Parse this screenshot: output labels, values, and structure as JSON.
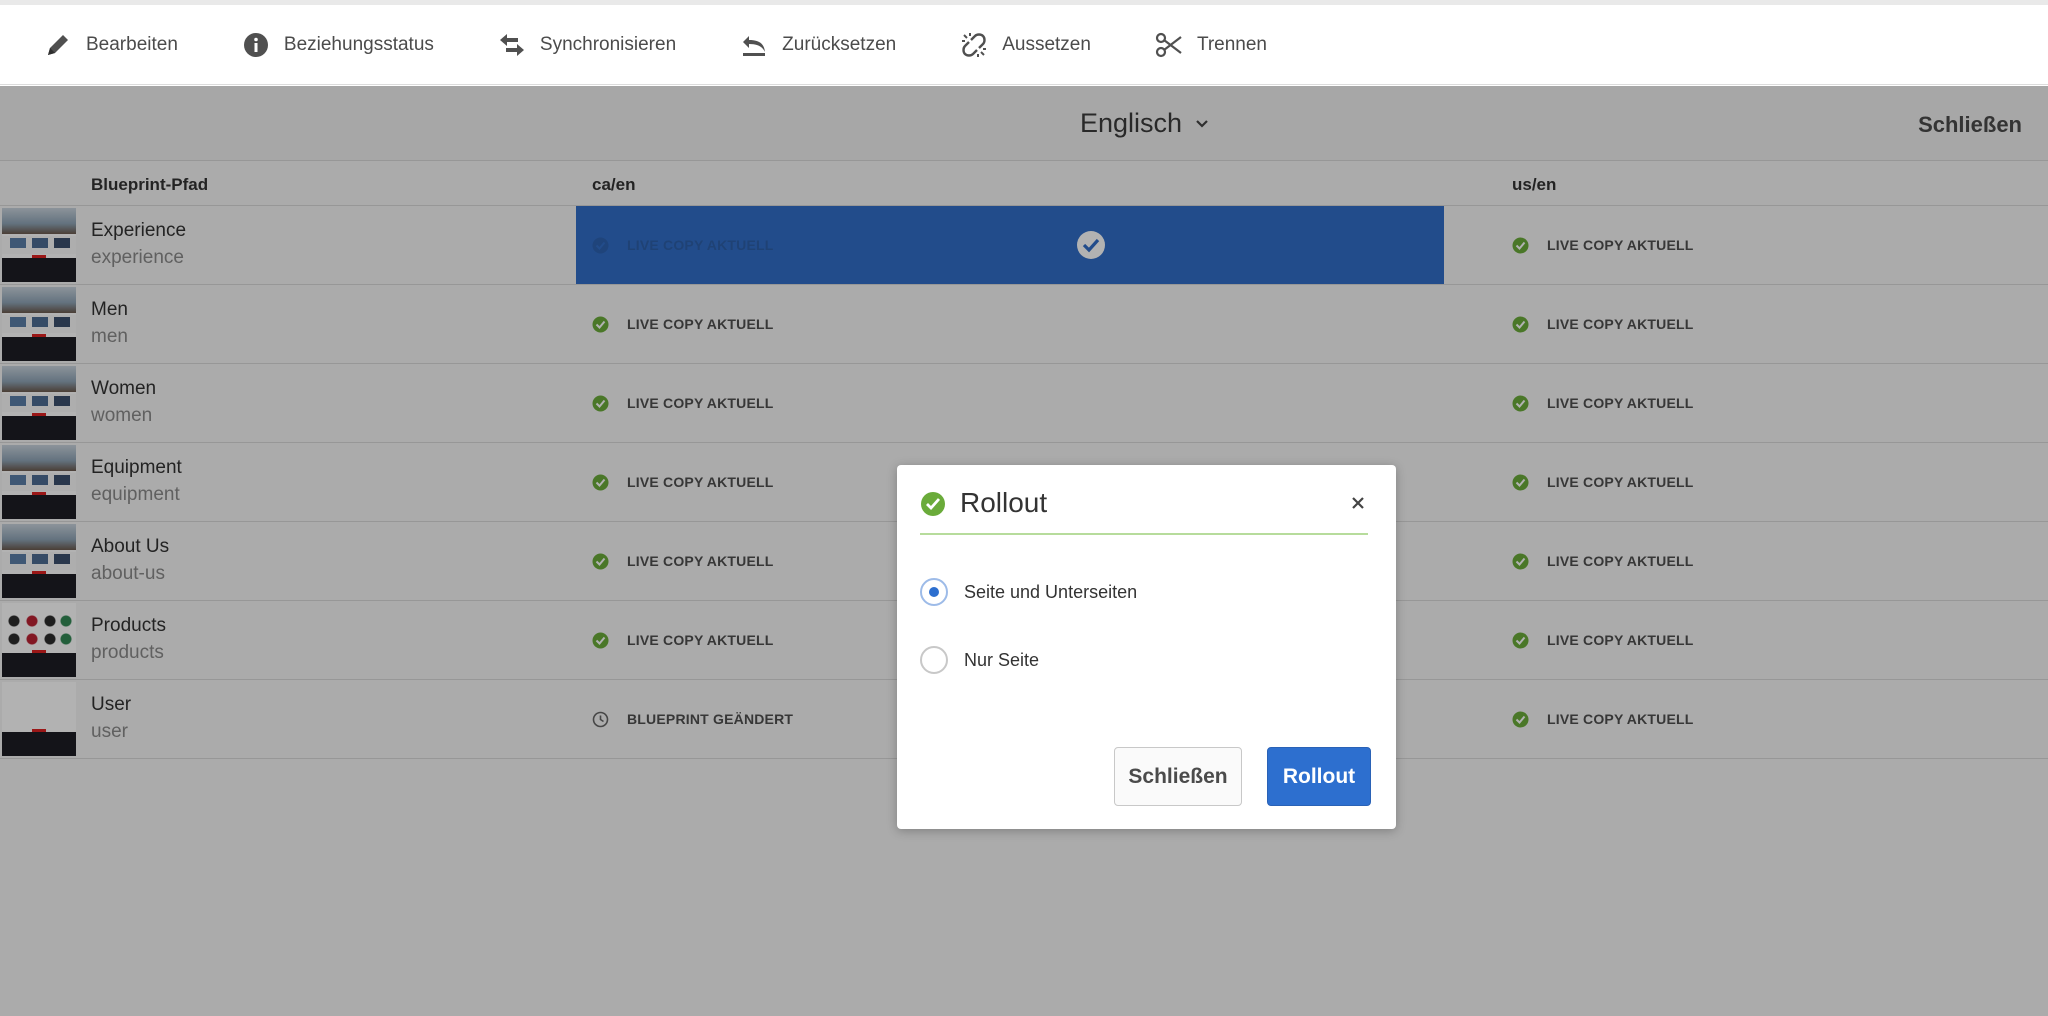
{
  "toolbar": {
    "items": [
      {
        "label": "Bearbeiten",
        "icon": "pencil-icon"
      },
      {
        "label": "Beziehungsstatus",
        "icon": "info-icon"
      },
      {
        "label": "Synchronisieren",
        "icon": "sync-arrows-icon"
      },
      {
        "label": "Zurücksetzen",
        "icon": "undo-icon"
      },
      {
        "label": "Aussetzen",
        "icon": "broken-link-icon"
      },
      {
        "label": "Trennen",
        "icon": "scissors-icon"
      }
    ]
  },
  "header": {
    "language": "Englisch",
    "close_label": "Schließen"
  },
  "table": {
    "columns": [
      "Blueprint-Pfad",
      "ca/en",
      "us/en"
    ],
    "rows": [
      {
        "title": "Experience",
        "name": "experience",
        "ca_status": "LIVE COPY AKTUELL",
        "us_status": "LIVE COPY AKTUELL"
      },
      {
        "title": "Men",
        "name": "men",
        "ca_status": "LIVE COPY AKTUELL",
        "us_status": "LIVE COPY AKTUELL"
      },
      {
        "title": "Women",
        "name": "women",
        "ca_status": "LIVE COPY AKTUELL",
        "us_status": "LIVE COPY AKTUELL"
      },
      {
        "title": "Equipment",
        "name": "equipment",
        "ca_status": "LIVE COPY AKTUELL",
        "us_status": "LIVE COPY AKTUELL"
      },
      {
        "title": "About Us",
        "name": "about-us",
        "ca_status": "LIVE COPY AKTUELL",
        "us_status": "LIVE COPY AKTUELL"
      },
      {
        "title": "Products",
        "name": "products",
        "ca_status": "LIVE COPY AKTUELL",
        "us_status": "LIVE COPY AKTUELL"
      },
      {
        "title": "User",
        "name": "user",
        "ca_status": "BLUEPRINT GEÄNDERT",
        "us_status": "LIVE COPY AKTUELL"
      }
    ]
  },
  "dialog": {
    "title": "Rollout",
    "options": [
      "Seite und Unterseiten",
      "Nur Seite"
    ],
    "selected_option": "Seite und Unterseiten",
    "close_button": "Schließen",
    "rollout_button": "Rollout"
  },
  "colors": {
    "accent": "#2d6fcf",
    "success": "#6aab3a",
    "selected_cell": "#326ec8"
  }
}
